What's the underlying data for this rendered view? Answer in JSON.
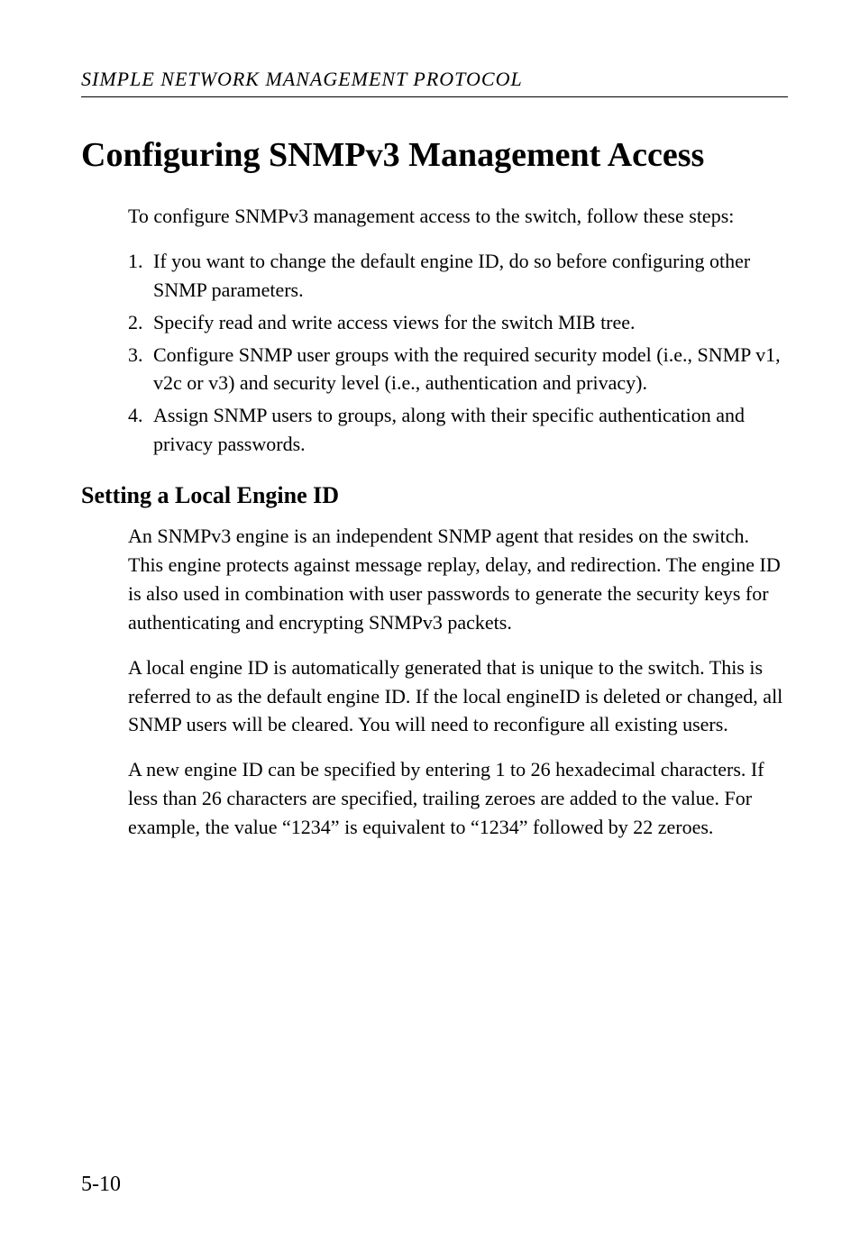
{
  "running_header": "SIMPLE NETWORK MANAGEMENT PROTOCOL",
  "main_heading": "Configuring SNMPv3 Management Access",
  "intro": "To configure SNMPv3 management access to the switch, follow these steps:",
  "list": [
    {
      "num": "1.",
      "text": "If you want to change the default engine ID, do so before configuring other SNMP parameters."
    },
    {
      "num": "2.",
      "text": "Specify read and write access views for the switch MIB tree."
    },
    {
      "num": "3.",
      "text": "Configure SNMP user groups with the required security model (i.e., SNMP v1, v2c or v3) and security level (i.e., authentication and privacy)."
    },
    {
      "num": "4.",
      "text": "Assign SNMP users to groups, along with their specific authentication and privacy passwords."
    }
  ],
  "sub_heading": "Setting a Local Engine ID",
  "paragraphs": [
    "An SNMPv3 engine is an independent SNMP agent that resides on the switch. This engine protects against message replay, delay, and redirection. The engine ID is also used in combination with user passwords to generate the security keys for authenticating and encrypting SNMPv3 packets.",
    "A local engine ID is automatically generated that is unique to the switch. This is referred to as the default engine ID. If the local engineID is deleted or changed, all SNMP users will be cleared. You will need to reconfigure all existing users.",
    "A new engine ID can be specified by entering 1 to 26 hexadecimal characters. If less than 26 characters are specified, trailing zeroes are added to the value. For example, the value “1234” is equivalent to “1234” followed by 22 zeroes."
  ],
  "page_number": "5-10"
}
